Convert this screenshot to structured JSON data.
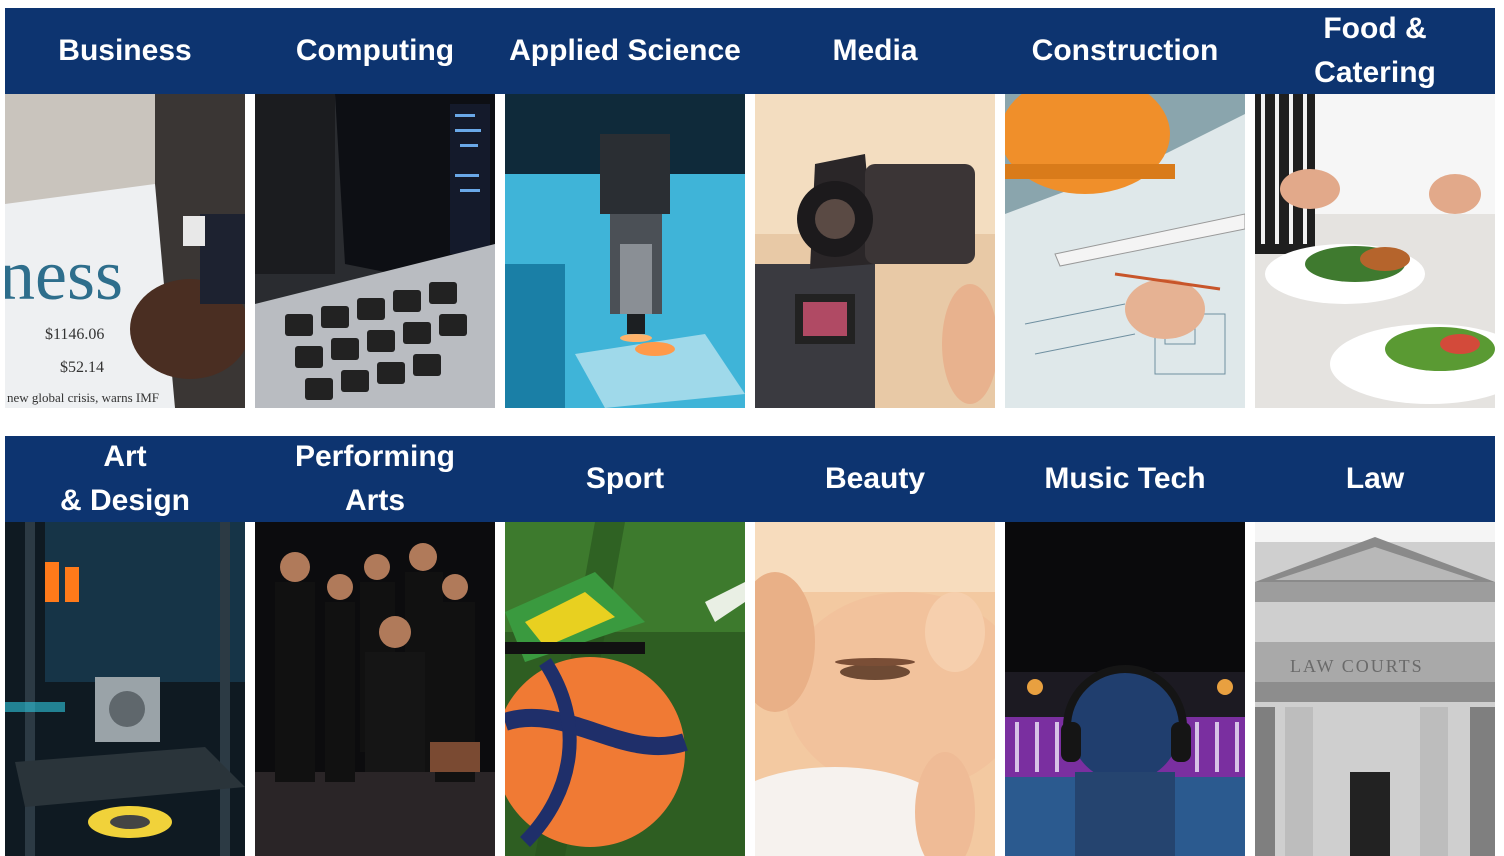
{
  "row1": [
    {
      "label": "Business",
      "image": "newspaper-photo"
    },
    {
      "label": "Computing",
      "image": "laptop-photo"
    },
    {
      "label": "Applied Science",
      "image": "microscope-photo"
    },
    {
      "label": "Media",
      "image": "camera-photo"
    },
    {
      "label": "Construction",
      "image": "blueprint-photo"
    },
    {
      "label": "Food &\nCatering",
      "image": "plated-food-photo"
    }
  ],
  "row2": [
    {
      "label": "Art\n& Design",
      "image": "3d-printer-photo"
    },
    {
      "label": "Performing\nArts",
      "image": "drama-group-photo"
    },
    {
      "label": "Sport",
      "image": "football-photo"
    },
    {
      "label": "Beauty",
      "image": "facial-treatment-photo"
    },
    {
      "label": "Music Tech",
      "image": "headphones-mixing-desk-photo"
    },
    {
      "label": "Law",
      "image": "law-courts-photo"
    }
  ],
  "photo_text": {
    "newspaper_headline": "ness",
    "newspaper_price1": "$1146.06",
    "newspaper_price2": "$52.14",
    "newspaper_caption": "new global crisis, warns IMF",
    "courts_inscription": "LAW COURTS"
  },
  "colors": {
    "band": "#0d3470",
    "label_text": "#ffffff"
  }
}
